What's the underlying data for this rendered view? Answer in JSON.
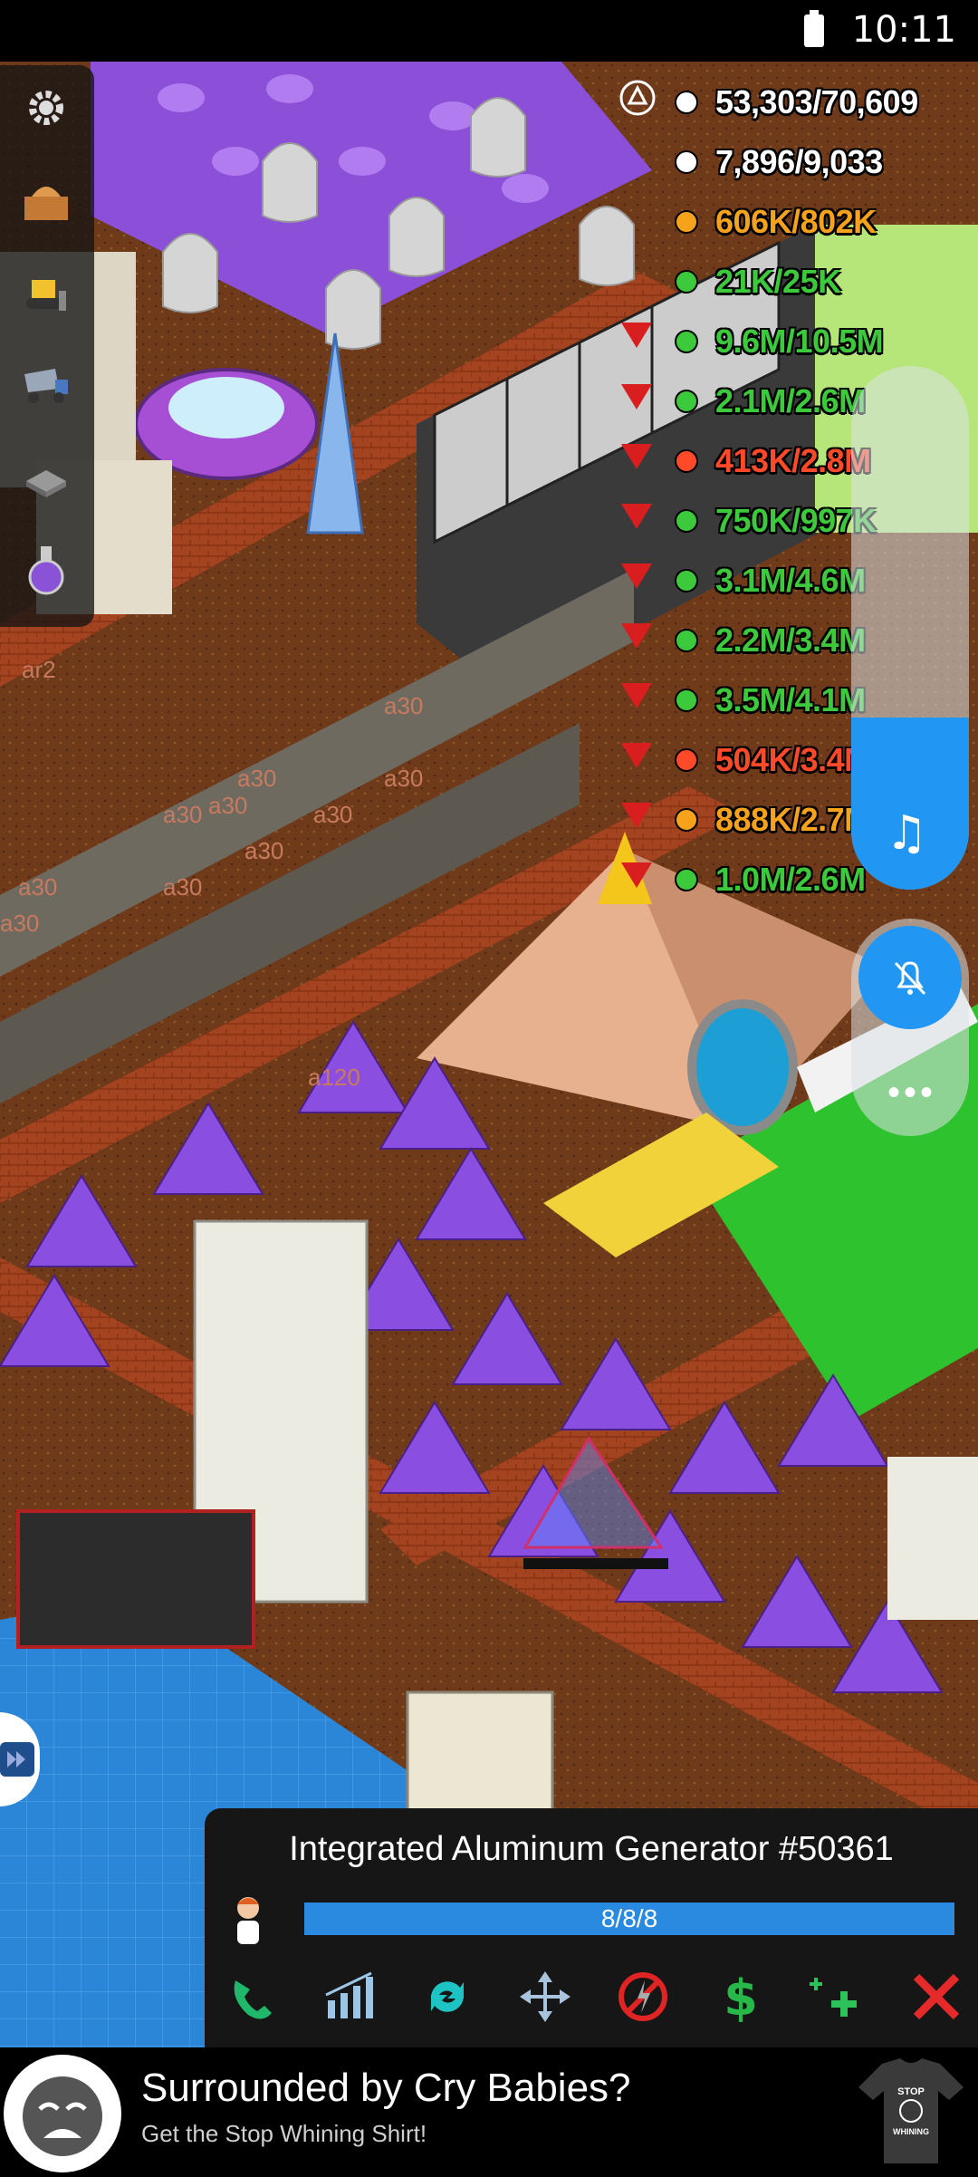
{
  "status_bar": {
    "time": "10:11"
  },
  "resources": [
    {
      "icon": "worker-yellow-icon",
      "value": "53,303/70,609",
      "color": "#ffffff"
    },
    {
      "icon": "worker-red-icon",
      "value": "7,896/9,033",
      "color": "#ffffff"
    },
    {
      "icon": "lightning-icon",
      "value": "606K/802K",
      "color": "#f7a21b"
    },
    {
      "icon": "network-icon",
      "value": "21K/25K",
      "color": "#3cc93c"
    },
    {
      "icon": "water-drop-icon",
      "value": "9.6M/10.5M",
      "color": "#3cc93c"
    },
    {
      "icon": "oil-barrel-icon",
      "value": "2.1M/2.6M",
      "color": "#3cc93c"
    },
    {
      "icon": "meat-icon",
      "value": "413K/2.8M",
      "color": "#ff4a2a"
    },
    {
      "icon": "coal-icon",
      "value": "750K/997K",
      "color": "#3cc93c"
    },
    {
      "icon": "bread-icon",
      "value": "3.1M/4.6M",
      "color": "#3cc93c"
    },
    {
      "icon": "aluminum-ingot-icon",
      "value": "2.2M/3.4M",
      "color": "#3cc93c"
    },
    {
      "icon": "wood-icon",
      "value": "3.5M/4.1M",
      "color": "#3cc93c"
    },
    {
      "icon": "steel-drum-icon",
      "value": "504K/3.4M",
      "color": "#ff4a2a"
    },
    {
      "icon": "bulb-icon",
      "value": "888K/2.7M",
      "color": "#f7a21b"
    },
    {
      "icon": "chip-icon",
      "value": "1.0M/2.6M",
      "color": "#3cc93c"
    }
  ],
  "toolbar": [
    "gear-icon",
    "building-icon",
    "bulldozer-icon",
    "dump-truck-icon",
    "factory-icon",
    "potion-icon"
  ],
  "info_panel": {
    "title": "Integrated Aluminum Generator #50361",
    "workers": "8/8/8",
    "actions": [
      "connect-icon",
      "stats-icon",
      "refresh-icon",
      "move-icon",
      "disable-icon",
      "sell-icon",
      "upgrade-icon",
      "close-icon"
    ]
  },
  "ad": {
    "headline": "Surrounded by Cry Babies?",
    "subline": "Get the Stop Whining Shirt!",
    "shirt_text": "STOP WHINING"
  },
  "map_labels": [
    "ar2",
    "a30",
    "a30",
    "a30",
    "a30",
    "a30",
    "a30",
    "a30",
    "a30",
    "a30",
    "a30",
    "a120"
  ],
  "colors": {
    "accent": "#2196f3",
    "warning_triangle": "#d81e1e",
    "dirt": "#7a3d1c",
    "grass": "#2fc22f",
    "purple_buildings": "#8c4fd8"
  }
}
